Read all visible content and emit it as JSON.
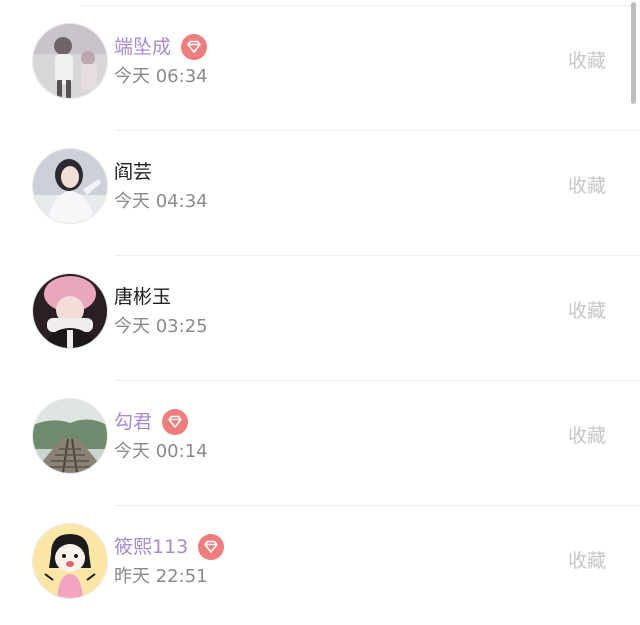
{
  "list": {
    "items": [
      {
        "name": "端坠成",
        "vip": true,
        "time": "今天 06:34",
        "action": "收藏",
        "avatar_icon": "avatar-photo-girl-white-dress"
      },
      {
        "name": "阎芸",
        "vip": false,
        "time": "今天 04:34",
        "action": "收藏",
        "avatar_icon": "avatar-photo-girl-white-top"
      },
      {
        "name": "唐彬玉",
        "vip": false,
        "time": "今天 03:25",
        "action": "收藏",
        "avatar_icon": "avatar-photo-girl-pink-hat"
      },
      {
        "name": "勾君",
        "vip": true,
        "time": "今天 00:14",
        "action": "收藏",
        "avatar_icon": "avatar-photo-railway"
      },
      {
        "name": "筱熙113",
        "vip": true,
        "time": "昨天 22:51",
        "action": "收藏",
        "avatar_icon": "avatar-cartoon-girl"
      }
    ]
  },
  "colors": {
    "vip_name": "#a889d8",
    "normal_name": "#1f1f1f",
    "time": "#8a8a8a",
    "collect": "#c7c7c7",
    "vip_badge": "#f07d7d"
  },
  "icons": {
    "vip_badge": "diamond-icon"
  }
}
